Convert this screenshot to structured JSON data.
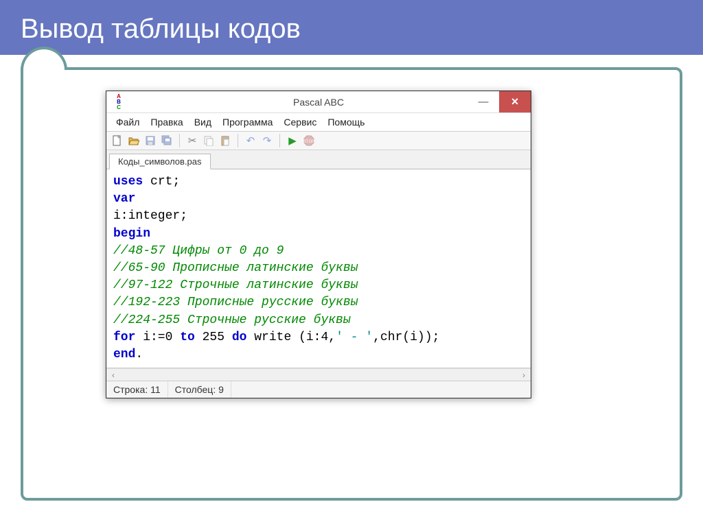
{
  "slide": {
    "title": "Вывод таблицы кодов"
  },
  "window": {
    "title": "Pascal ABC",
    "menu": {
      "file": "Файл",
      "edit": "Правка",
      "view": "Вид",
      "program": "Программа",
      "service": "Сервис",
      "help": "Помощь"
    },
    "tab": "Коды_символов.pas",
    "code": {
      "l1_kw": "uses",
      "l1_rest": " crt;",
      "l2_kw": "var",
      "l3": "i:integer;",
      "l4_kw": "begin",
      "l5_cm": "//48-57 Цифры от 0 до 9",
      "l6_cm": "//65-90 Прописные латинские буквы",
      "l7_cm": "//97-122 Строчные латинские буквы",
      "l8_cm": "//192-223 Прописные русские буквы",
      "l9_cm": "//224-255 Строчные русские буквы",
      "l10_kw1": "for",
      "l10_a": " i:=0 ",
      "l10_kw2": "to",
      "l10_b": " 255 ",
      "l10_kw3": "do",
      "l10_c": " write (i:4,",
      "l10_str": "' - '",
      "l10_d": ",chr(i));",
      "l11_kw": "end",
      "l11_rest": "."
    },
    "status": {
      "line": "Строка: 11",
      "col": "Столбец: 9"
    }
  }
}
